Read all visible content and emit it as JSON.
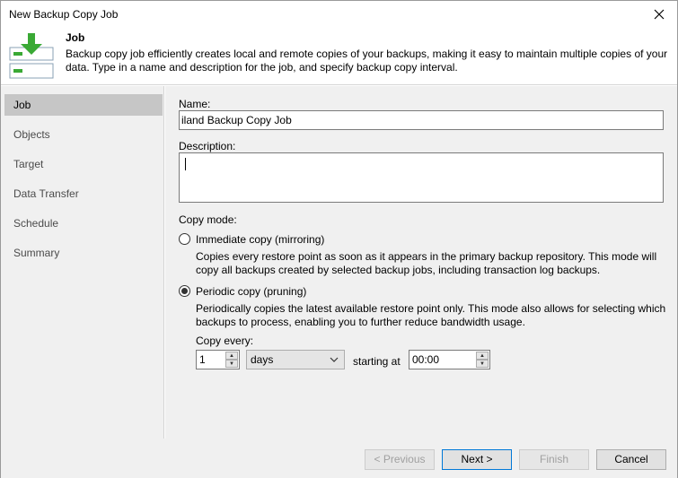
{
  "window": {
    "title": "New Backup Copy Job"
  },
  "header": {
    "title": "Job",
    "description": "Backup copy job efficiently creates local and remote copies of your backups, making it easy to maintain multiple copies of your data. Type in a name and description for the job, and specify backup copy interval."
  },
  "sidebar": {
    "items": [
      {
        "label": "Job",
        "active": true
      },
      {
        "label": "Objects"
      },
      {
        "label": "Target"
      },
      {
        "label": "Data Transfer"
      },
      {
        "label": "Schedule"
      },
      {
        "label": "Summary"
      }
    ]
  },
  "form": {
    "name_label": "Name:",
    "name_value": "iland Backup Copy Job",
    "description_label": "Description:",
    "description_value": "",
    "copy_mode_label": "Copy mode:",
    "immediate": {
      "label": "Immediate copy (mirroring)",
      "description": "Copies every restore point as soon as it appears in the primary backup repository. This mode will copy all backups created by selected backup jobs, including transaction log backups.",
      "checked": false
    },
    "periodic": {
      "label": "Periodic copy (pruning)",
      "description": "Periodically copies the latest available restore point only. This mode also allows for selecting which backups to process, enabling you to further reduce bandwidth usage.",
      "checked": true
    },
    "copy_every_label": "Copy every:",
    "copy_every_value": "1",
    "unit_value": "days",
    "starting_at_label": "starting at",
    "starting_at_value": "00:00"
  },
  "footer": {
    "previous": "< Previous",
    "next": "Next >",
    "finish": "Finish",
    "cancel": "Cancel"
  },
  "icons": {
    "header_icon": "backup-copy-job-icon",
    "close": "close-icon"
  },
  "colors": {
    "accent_green": "#3aa935",
    "active_nav": "#c6c6c6",
    "primary_border": "#0078d7"
  }
}
